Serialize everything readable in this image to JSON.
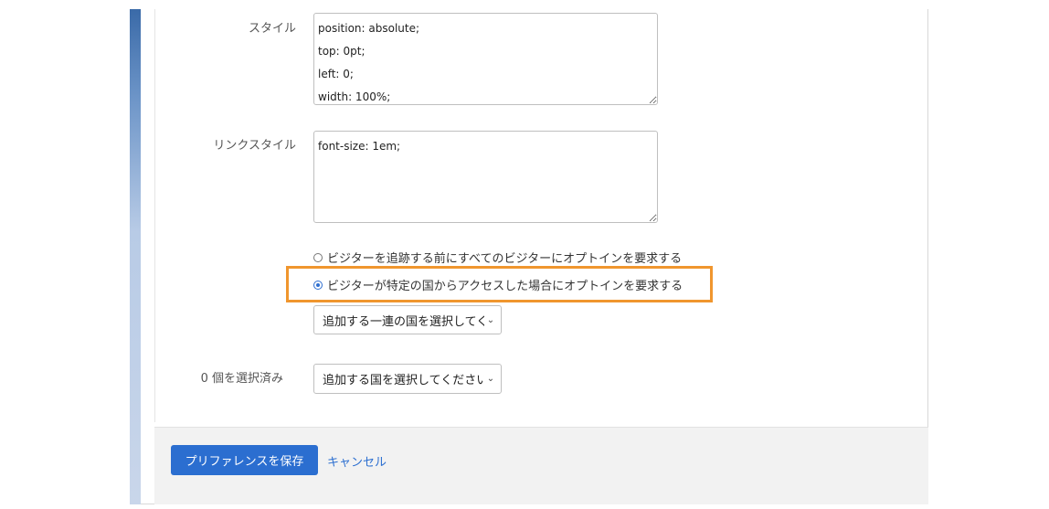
{
  "form": {
    "style": {
      "label": "スタイル",
      "value": "position: absolute;\ntop: 0pt;\nleft: 0;\nwidth: 100%;"
    },
    "link_style": {
      "label": "リンクスタイル",
      "value": "font-size: 1em;"
    },
    "optin_options": [
      {
        "label": "ビジターを追跡する前にすべてのビジターにオプトインを要求する",
        "checked": false
      },
      {
        "label": "ビジターが特定の国からアクセスした場合にオプトインを要求する",
        "checked": true
      }
    ],
    "country_group_select": {
      "value": "追加する一連の国を選択してく"
    },
    "selected_count_label": "0 個を選択済み",
    "country_select": {
      "value": "追加する国を選択してください"
    }
  },
  "footer": {
    "save_label": "プリファレンスを保存",
    "cancel_label": "キャンセル"
  },
  "colors": {
    "accent": "#2b6ed0",
    "highlight": "#f0962e"
  }
}
